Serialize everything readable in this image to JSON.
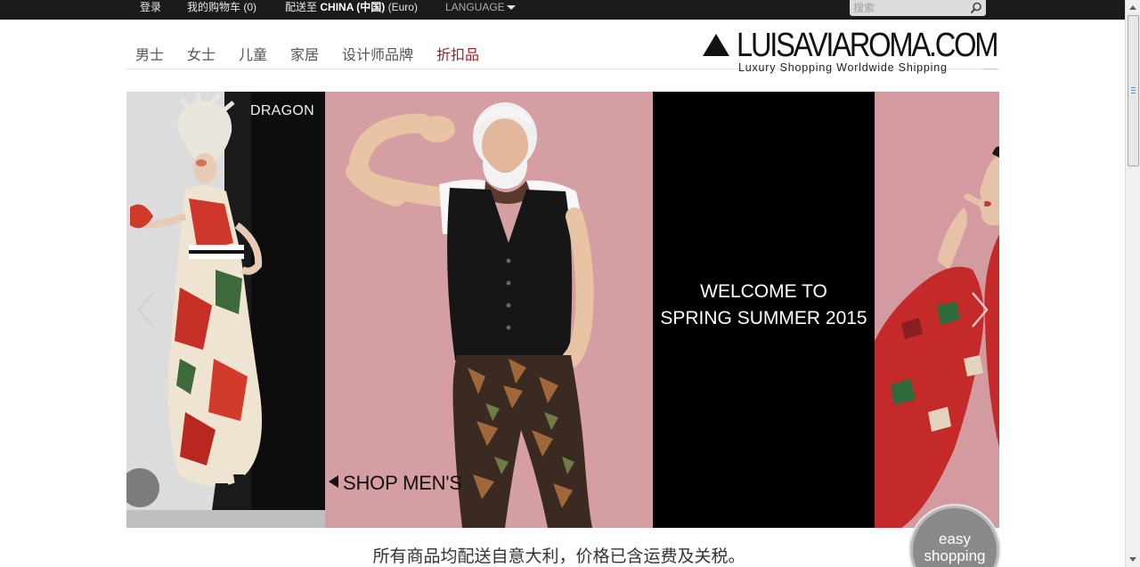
{
  "topbar": {
    "login": "登录",
    "cart": "我的购物车 (0)",
    "ship_prefix": "配送至",
    "ship_country": "CHINA (中国)",
    "ship_currency": "(Euro)",
    "language": "LANGUAGE",
    "search_placeholder": "搜索"
  },
  "nav": {
    "items": [
      "男士",
      "女士",
      "儿童",
      "家居",
      "设计师品牌",
      "折扣品"
    ]
  },
  "logo": {
    "name": "LUISAVIAROMA.COM",
    "tagline": "Luxury Shopping Worldwide Shipping"
  },
  "hero": {
    "dragon": "DRAGON",
    "shop_mens": "SHOP MEN'S",
    "welcome_line1": "WELCOME TO",
    "welcome_line2": "SPRING SUMMER 2015"
  },
  "footnote": "所有商品均配送自意大利，价格已含运费及关税。",
  "easy_shopping": {
    "line1": "easy",
    "line2": "shopping"
  },
  "colors": {
    "topbar_bg": "#1b1b1b",
    "sale_nav": "#a51c1c",
    "hero_pink": "#d49ea2"
  },
  "icons": [
    "search-icon",
    "chevron-left-icon",
    "chevron-right-icon",
    "caret-down-icon",
    "logo-triangle-icon"
  ]
}
